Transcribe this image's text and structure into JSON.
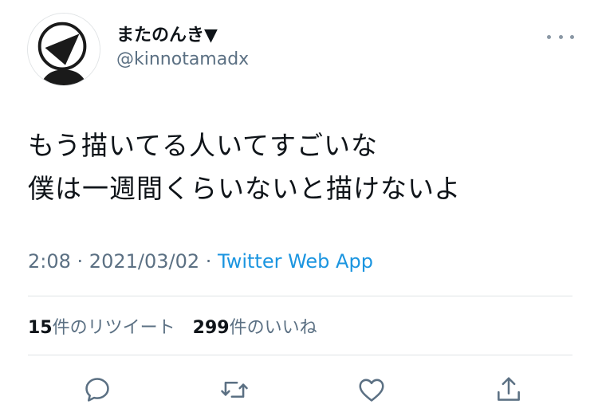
{
  "user": {
    "display_name": "またのんき▼",
    "handle": "@kinnotamadx"
  },
  "tweet": {
    "lines": [
      "もう描いてる人いてすごいな",
      "僕は一週間くらいないと描けないよ"
    ]
  },
  "meta": {
    "time": "2:08",
    "sep1": " · ",
    "date": "2021/03/02",
    "sep2": " · ",
    "source": "Twitter Web App"
  },
  "stats": {
    "retweet_count": "15",
    "retweet_label": "件のリツイート",
    "like_count": "299",
    "like_label": "件のいいね"
  },
  "icons": {
    "more": "more-horizontal-icon",
    "reply": "reply-icon",
    "retweet": "retweet-icon",
    "like": "heart-icon",
    "share": "share-icon"
  },
  "colors": {
    "text": "#0f1419",
    "secondary": "#5b7083",
    "link": "#1b95e0",
    "icon": "#5b7083"
  }
}
